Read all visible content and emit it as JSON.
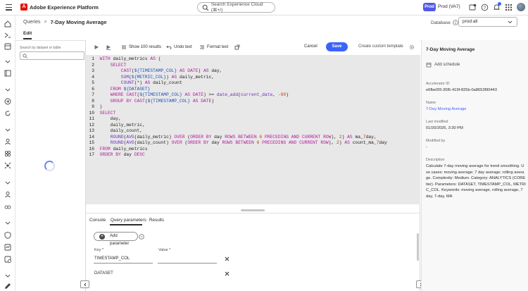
{
  "app": {
    "title": "Adobe Experience Platform",
    "search_placeholder": "Search Experience Cloud (⌘+/)",
    "env_badge": "Prod",
    "sandbox": "Prod (VA7)"
  },
  "header": {
    "breadcrumb_parent": "Queries",
    "breadcrumb_sep": ">",
    "breadcrumb_current": "7-Day Moving Average",
    "database_label": "Database",
    "database_value": "prod:all",
    "tab_edit": "Edit"
  },
  "left_panel": {
    "dataset_search_label": "Search by dataset or table",
    "dataset_search_placeholder": ""
  },
  "toolbar": {
    "show_results": "Show 100 results",
    "undo": "Undo text",
    "format": "Format text",
    "cancel": "Cancel",
    "save": "Save",
    "custom_template": "Create custom template"
  },
  "editor": {
    "lines": [
      "WITH daily_metrics AS (",
      "    SELECT",
      "        CAST(${TIMESTAMP_COL} AS DATE) AS day,",
      "        SUM(${METRIC_COL}) AS daily_metric,",
      "        COUNT(*) AS daily_count",
      "    FROM ${DATASET}",
      "    WHERE CAST(${TIMESTAMP_COL} AS DATE) >= date_add(current_date, -90)",
      "    GROUP BY CAST(${TIMESTAMP_COL} AS DATE)",
      ")",
      "SELECT",
      "    day,",
      "    daily_metric,",
      "    daily_count,",
      "    ROUND(AVG(daily_metric) OVER (ORDER BY day ROWS BETWEEN 6 PRECEDING AND CURRENT ROW), 2) AS ma_7day,",
      "    ROUND(AVG(daily_count) OVER (ORDER BY day ROWS BETWEEN 6 PRECEDING AND CURRENT ROW), 2) AS count_ma_7day",
      "FROM daily_metrics",
      "ORDER BY day DESC"
    ]
  },
  "bottom": {
    "tabs": [
      "Console",
      "Query parameters",
      "Results"
    ],
    "active_tab": "Query parameters",
    "add_parameter": "Add parameter",
    "key_label": "Key",
    "value_label": "Value",
    "required_mark": "*",
    "params": [
      {
        "key": "TIMESTAMP_COL",
        "value": ""
      },
      {
        "key": "DATASET",
        "value": ""
      }
    ]
  },
  "right_panel": {
    "title": "7-Day Moving Average",
    "add_schedule": "Add schedule",
    "accelerator_id_label": "Accelerator ID",
    "accelerator_id": "e6fbe0f3-35f6-419f-825b-0a8653f90443",
    "name_label": "Name",
    "name": "7-Day Moving Average",
    "last_modified_label": "Last modified",
    "last_modified": "01/20/2026, 3:30 PM",
    "modified_by_label": "Modified by",
    "modified_by": "-",
    "description_label": "Description",
    "description": "Calculate 7-day moving average for trend smoothing. Use cases: moving average; 7 day average; rolling average. Complexity: Medium. Category: ANALYTICS (CORE tier). Parameters: DATASET, TIMESTAMP_COL, METRIC_COL. Keywords: moving average, rolling average, 7 day, 7-day, MA"
  },
  "colors": {
    "accent": "#3b63fb",
    "env_badge": "#5258e4",
    "brand": "#eb1000"
  }
}
